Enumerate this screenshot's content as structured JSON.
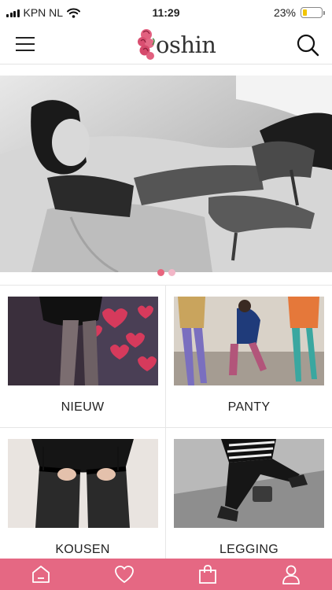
{
  "status_bar": {
    "carrier": "KPN NL",
    "time": "11:29",
    "battery": "23%",
    "battery_level": 0.23
  },
  "header": {
    "logo_text": "oshin",
    "menu_icon": "hamburger-menu-icon",
    "search_icon": "search-icon"
  },
  "hero": {
    "slide_count": 2,
    "active_slide": 1
  },
  "categories": [
    {
      "label": "NIEUW"
    },
    {
      "label": "PANTY"
    },
    {
      "label": "KOUSEN"
    },
    {
      "label": "LEGGING"
    }
  ],
  "tabbar": {
    "items": [
      "home-icon",
      "heart-icon",
      "shopping-bag-icon",
      "user-icon"
    ]
  },
  "colors": {
    "accent": "#e56883",
    "dot_active": "#e8657e",
    "dot_inactive": "#f2b6c7",
    "battery": "#f2c500"
  }
}
